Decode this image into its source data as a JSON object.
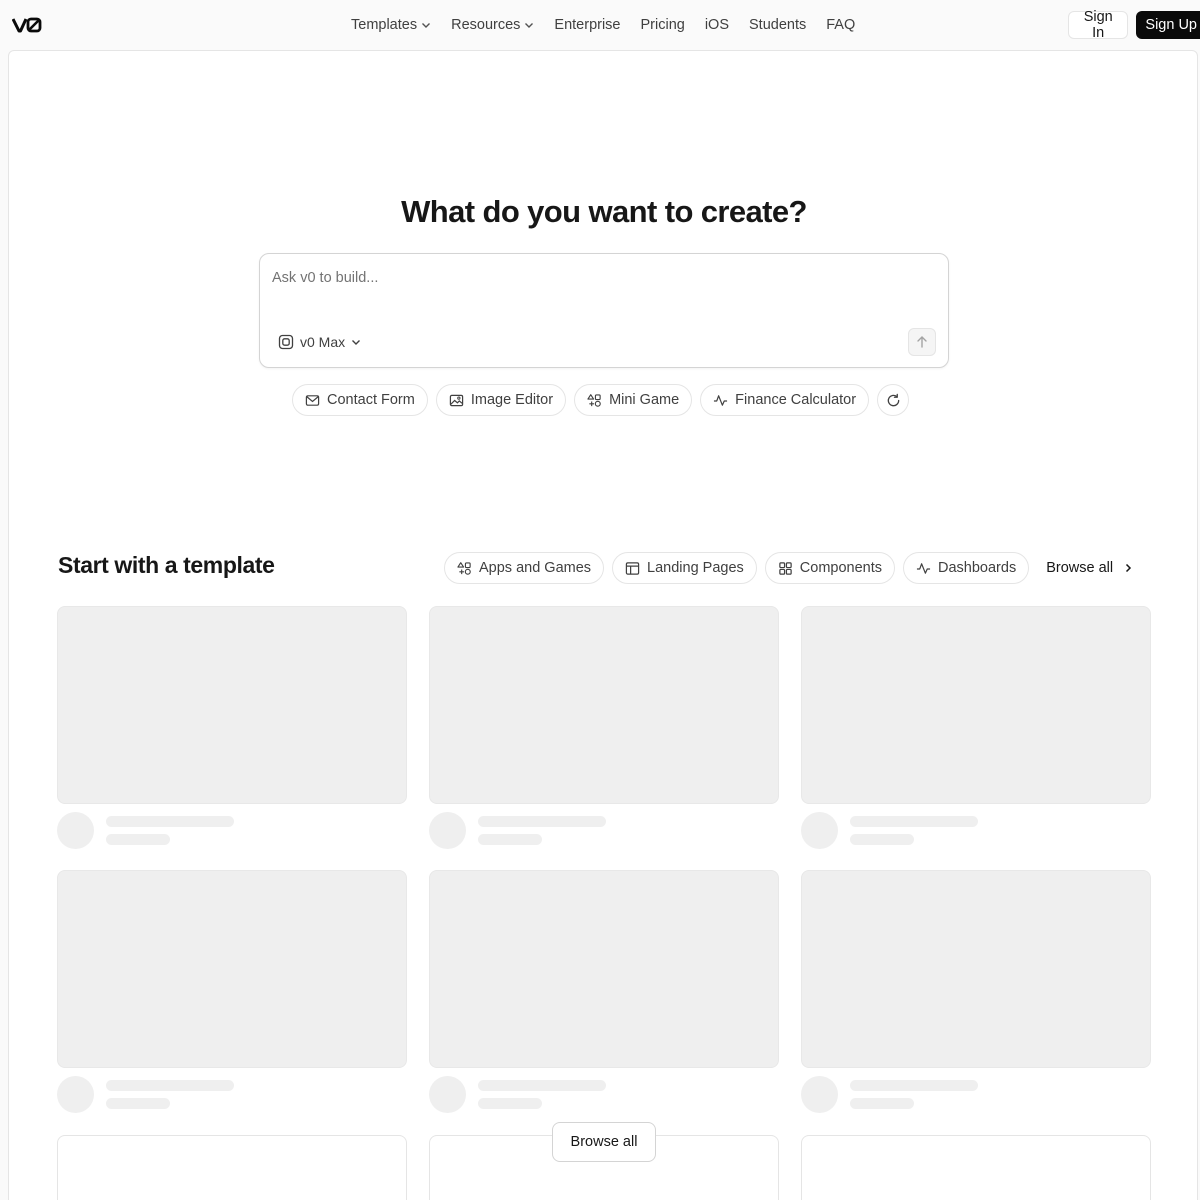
{
  "brand": {
    "logo": "v0-logo-icon"
  },
  "nav": {
    "items": [
      {
        "label": "Templates",
        "has_dropdown": true
      },
      {
        "label": "Resources",
        "has_dropdown": true
      },
      {
        "label": "Enterprise"
      },
      {
        "label": "Pricing"
      },
      {
        "label": "iOS"
      },
      {
        "label": "Students"
      },
      {
        "label": "FAQ"
      }
    ]
  },
  "auth": {
    "sign_in": "Sign In",
    "sign_up": "Sign Up"
  },
  "hero": {
    "title": "What do you want to create?",
    "prompt_placeholder": "Ask v0 to build...",
    "model": "v0 Max",
    "send_icon": "arrow-up-icon"
  },
  "suggestions": [
    {
      "label": "Contact Form",
      "icon": "mail-icon"
    },
    {
      "label": "Image Editor",
      "icon": "image-icon"
    },
    {
      "label": "Mini Game",
      "icon": "shapes-icon"
    },
    {
      "label": "Finance Calculator",
      "icon": "activity-icon"
    }
  ],
  "refresh_icon": "refresh-icon",
  "templates": {
    "title": "Start with a template",
    "filters": [
      {
        "label": "Apps and Games",
        "icon": "shapes-icon"
      },
      {
        "label": "Landing Pages",
        "icon": "layout-icon"
      },
      {
        "label": "Components",
        "icon": "grid-icon"
      },
      {
        "label": "Dashboards",
        "icon": "activity-icon"
      }
    ],
    "browse_all": "Browse all",
    "browse_all_button": "Browse all"
  },
  "colors": {
    "background": "#fafafa",
    "panel": "#ffffff",
    "border": "#e5e5e5",
    "skeleton": "#efefef",
    "text": "#171717",
    "muted": "#737373",
    "primary_button": "#0a0a0a"
  }
}
